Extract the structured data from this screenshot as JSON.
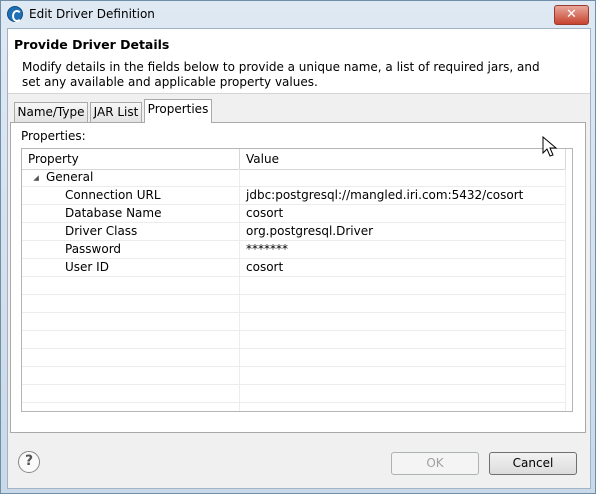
{
  "window": {
    "title": "Edit Driver Definition",
    "close_glyph": "✕"
  },
  "header": {
    "title": "Provide Driver Details",
    "description": "Modify details in the fields below to provide a unique name, a list of required jars, and set any available and applicable property values."
  },
  "tabs": [
    {
      "label": "Name/Type",
      "active": false
    },
    {
      "label": "JAR List",
      "active": false
    },
    {
      "label": "Properties",
      "active": true
    }
  ],
  "properties_panel": {
    "label": "Properties:",
    "columns": [
      "Property",
      "Value"
    ],
    "group": {
      "name": "General",
      "expanded": true
    },
    "rows": [
      {
        "property": "Connection URL",
        "value": "jdbc:postgresql://mangled.iri.com:5432/cosort"
      },
      {
        "property": "Database Name",
        "value": "cosort"
      },
      {
        "property": "Driver Class",
        "value": "org.postgresql.Driver"
      },
      {
        "property": "Password",
        "value": "*******"
      },
      {
        "property": "User ID",
        "value": "cosort"
      }
    ]
  },
  "footer": {
    "help_glyph": "?",
    "ok_label": "OK",
    "ok_enabled": false,
    "cancel_label": "Cancel"
  },
  "icons": {
    "app": "eclipse-app-icon",
    "close": "close-icon",
    "help": "help-icon",
    "expander": "tree-expanded-icon",
    "cursor": "mouse-pointer-icon"
  },
  "colors": {
    "close_button": "#c7432f",
    "window_frame": "#c9d9e8"
  }
}
